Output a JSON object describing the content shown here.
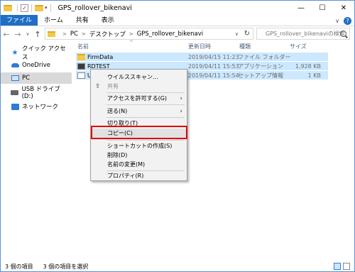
{
  "window": {
    "title": "GPS_rollover_bikenavi",
    "controls": {
      "minimize": "—",
      "maximize": "☐",
      "close": "✕"
    }
  },
  "ribbon": {
    "tabs": [
      "ファイル",
      "ホーム",
      "共有",
      "表示"
    ],
    "help": "?",
    "collapse": "∨"
  },
  "address": {
    "back": "←",
    "forward": "→",
    "recent": "∨",
    "up": "↑",
    "crumbs": [
      "PC",
      "デスクトップ",
      "GPS_rollover_bikenavi"
    ],
    "search_placeholder": "GPS_rollover_bikenaviの検索"
  },
  "nav": {
    "items": [
      {
        "label": "クイック アクセス",
        "icon": "star-icon"
      },
      {
        "label": "OneDrive",
        "icon": "cloud-icon"
      },
      {
        "label": "PC",
        "icon": "pc-icon"
      },
      {
        "label": "USB ドライブ (D:)",
        "icon": "usb-icon"
      },
      {
        "label": "ネットワーク",
        "icon": "network-icon"
      }
    ]
  },
  "files": {
    "columns": [
      "名前",
      "更新日時",
      "種類",
      "サイズ"
    ],
    "rows": [
      {
        "name": "FirmData",
        "date": "2019/04/15 11:23",
        "type": "ファイル フォルダー",
        "size": "",
        "icon": "folder-icon"
      },
      {
        "name": "RDTEST",
        "date": "2019/04/11 15:53",
        "type": "アプリケーション",
        "size": "1,928 KB",
        "icon": "application-icon"
      },
      {
        "name": "UP",
        "date": "2019/04/11 15:54",
        "type": "セットアップ情報",
        "size": "1 KB",
        "icon": "setup-file-icon"
      }
    ]
  },
  "context_menu": {
    "items": {
      "virus_scan": "ウイルススキャン...",
      "share": "共有",
      "grant_access": "アクセスを許可する(G)",
      "send_to": "送る(N)",
      "cut": "切り取り(T)",
      "copy": "コピー(C)",
      "create_shortcut": "ショートカットの作成(S)",
      "delete": "削除(D)",
      "rename": "名前の変更(M)",
      "properties": "プロパティ(R)"
    },
    "arrow": "›"
  },
  "status": {
    "count": "3 個の項目",
    "selected": "3 個の項目を選択"
  },
  "colors": {
    "accent": "#1f6fc5",
    "selection": "#cce8ff",
    "highlight_box": "#e00000"
  }
}
